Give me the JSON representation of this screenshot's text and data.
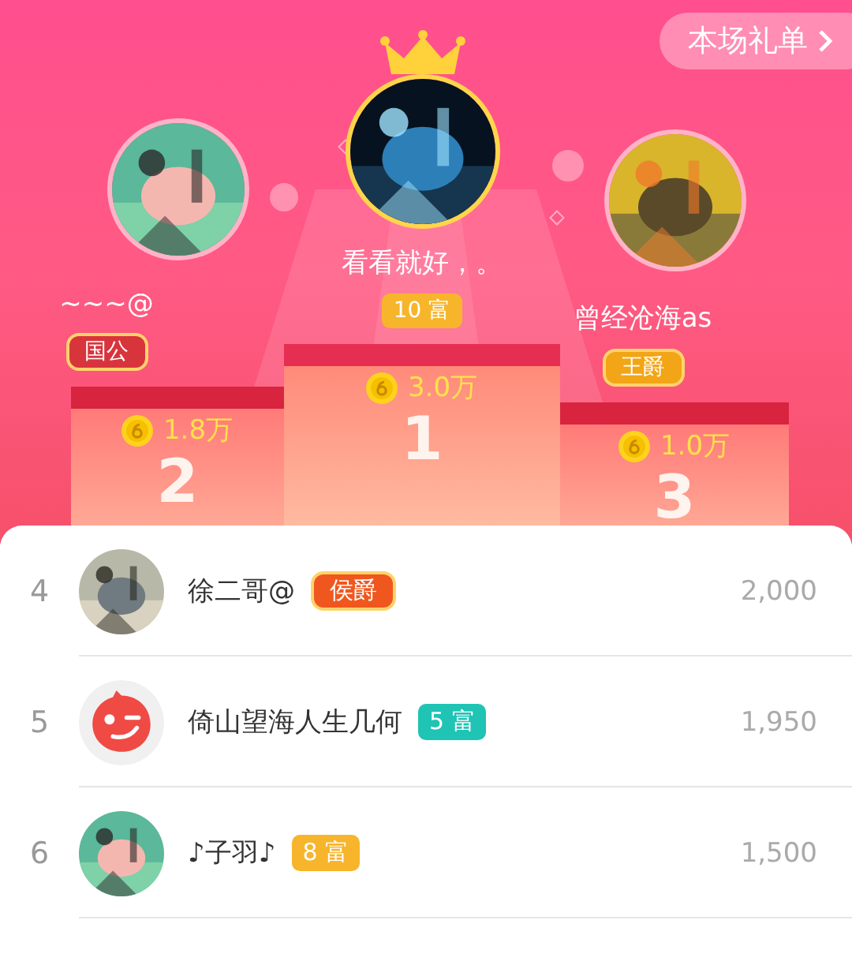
{
  "gift_list_button": {
    "label": "本场礼单"
  },
  "podium": [
    {
      "rank_number": "2",
      "name": "~~~@",
      "badge": {
        "kind": "title",
        "label": "国公",
        "color": "#d8343c"
      },
      "amount": "1.8万"
    },
    {
      "rank_number": "1",
      "name": "看看就好，。",
      "badge": {
        "kind": "wealth",
        "label": "10 富",
        "color": "#f7b52c"
      },
      "amount": "3.0万"
    },
    {
      "rank_number": "3",
      "name": "曾经沧海as",
      "badge": {
        "kind": "title",
        "label": "王爵",
        "color": "#f2a516"
      },
      "amount": "1.0万"
    }
  ],
  "rows": [
    {
      "rank": "4",
      "name": "徐二哥@",
      "badge": {
        "kind": "title",
        "label": "侯爵",
        "color": "#f0571e"
      },
      "amount": "2,000"
    },
    {
      "rank": "5",
      "name": "倚山望海人生几何",
      "badge": {
        "kind": "wealth",
        "label": "5 富",
        "color": "#1fc4b5"
      },
      "amount": "1,950",
      "avatar": {
        "kind": "default"
      }
    },
    {
      "rank": "6",
      "name": "♪子羽♪",
      "badge": {
        "kind": "wealth",
        "label": "8 富",
        "color": "#f7b52c"
      },
      "amount": "1,500"
    }
  ]
}
